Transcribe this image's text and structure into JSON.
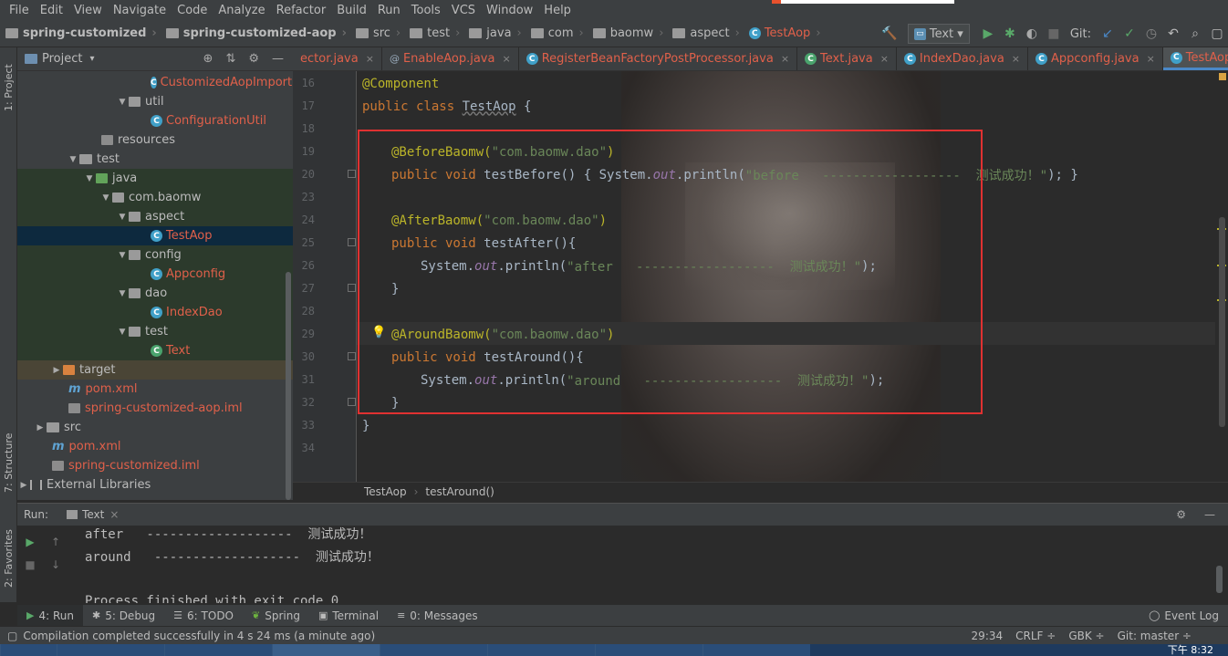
{
  "menu": [
    "File",
    "Edit",
    "View",
    "Navigate",
    "Code",
    "Analyze",
    "Refactor",
    "Build",
    "Run",
    "Tools",
    "VCS",
    "Window",
    "Help"
  ],
  "nav_breadcrumb": {
    "project": "spring-customized",
    "module": "spring-customized-aop",
    "path": [
      "src",
      "test",
      "java",
      "com",
      "baomw",
      "aspect"
    ],
    "file": "TestAop"
  },
  "toolbar": {
    "run_config": "Text",
    "git_label": "Git:"
  },
  "left_strip": {
    "project_tab": "1: Project",
    "structure_tab": "7: Structure",
    "favorites_tab": "2: Favorites"
  },
  "project_panel": {
    "title": "Project",
    "tree": [
      {
        "label": "CustomizedAopImportSelector",
        "kind": "class",
        "red": true
      },
      {
        "label": "util",
        "kind": "pkg"
      },
      {
        "label": "ConfigurationUtil",
        "kind": "class",
        "red": true
      },
      {
        "label": "resources",
        "kind": "res"
      },
      {
        "label": "test",
        "kind": "folder"
      },
      {
        "label": "java",
        "kind": "testsrc"
      },
      {
        "label": "com.baomw",
        "kind": "pkg"
      },
      {
        "label": "aspect",
        "kind": "pkg"
      },
      {
        "label": "TestAop",
        "kind": "class",
        "red": true,
        "selected": true
      },
      {
        "label": "config",
        "kind": "pkg"
      },
      {
        "label": "Appconfig",
        "kind": "class",
        "red": true
      },
      {
        "label": "dao",
        "kind": "pkg"
      },
      {
        "label": "IndexDao",
        "kind": "class",
        "red": true
      },
      {
        "label": "test",
        "kind": "pkg"
      },
      {
        "label": "Text",
        "kind": "class",
        "red": true
      },
      {
        "label": "target",
        "kind": "target"
      },
      {
        "label": "pom.xml",
        "kind": "m",
        "red": true
      },
      {
        "label": "spring-customized-aop.iml",
        "kind": "file",
        "red": true
      },
      {
        "label": "src",
        "kind": "folder"
      },
      {
        "label": "pom.xml",
        "kind": "m",
        "red": true
      },
      {
        "label": "spring-customized.iml",
        "kind": "file",
        "red": true
      },
      {
        "label": "External Libraries",
        "kind": "lib"
      }
    ]
  },
  "tabs": [
    {
      "label": "ector.java"
    },
    {
      "label": "EnableAop.java"
    },
    {
      "label": "RegisterBeanFactoryPostProcessor.java"
    },
    {
      "label": "Text.java"
    },
    {
      "label": "IndexDao.java"
    },
    {
      "label": "Appconfig.java"
    },
    {
      "label": "TestAop.java",
      "active": true
    }
  ],
  "tab_overflow": "≫4",
  "editor": {
    "line_numbers": [
      "16",
      "17",
      "18",
      "19",
      "20",
      "23",
      "24",
      "25",
      "26",
      "27",
      "28",
      "29",
      "30",
      "31",
      "32",
      "33",
      "34"
    ],
    "lines": {
      "l16": "@Component",
      "l17_kw": "public class ",
      "l17_name": "TestAop",
      "l17_tail": " {",
      "l19_ann": "@BeforeBaomw(",
      "l19_str": "\"com.baomw.dao\"",
      "l19_close": ")",
      "l20_kw": "public void ",
      "l20_name": "testBefore",
      "l20_a": "() { System.",
      "l20_out": "out",
      "l20_b": ".println(",
      "l20_str": "\"before   ------------------  测试成功！\"",
      "l20_c": "); }",
      "l24_ann": "@AfterBaomw(",
      "l24_str": "\"com.baomw.dao\"",
      "l24_close": ")",
      "l25_kw": "public void ",
      "l25_name": "testAfter",
      "l25_tail": "(){",
      "l26_a": "System.",
      "l26_out": "out",
      "l26_b": ".println(",
      "l26_str": "\"after   ------------------  测试成功！\"",
      "l26_c": ");",
      "l27": "}",
      "l29_ann": "@AroundBaomw(",
      "l29_str": "\"com.baomw.dao\"",
      "l29_close": ")",
      "l30_kw": "public void ",
      "l30_name": "testAround",
      "l30_tail": "(){",
      "l31_a": "System.",
      "l31_out": "out",
      "l31_b": ".println(",
      "l31_str": "\"around   ------------------  测试成功！\"",
      "l31_c": ");",
      "l32": "}",
      "l33": "}"
    }
  },
  "code_breadcrumb": [
    "TestAop",
    "testAround()"
  ],
  "run_panel": {
    "label": "Run:",
    "tab": "Text",
    "console": [
      "after   -------------------  测试成功！",
      "around   -------------------  测试成功！",
      "",
      "Process finished with exit code 0"
    ]
  },
  "bottom_tabs": {
    "run": "4: Run",
    "debug": "5: Debug",
    "todo": "6: TODO",
    "spring": "Spring",
    "terminal": "Terminal",
    "messages": "0: Messages",
    "event_log": "Event Log"
  },
  "status": {
    "message": "Compilation completed successfully in 4 s 24 ms (a minute ago)",
    "position": "29:34",
    "line_sep": "CRLF ÷",
    "encoding": "GBK ÷",
    "git_branch": "Git: master ÷"
  },
  "taskbar": {
    "clock": "下午 8:32"
  },
  "colors": {
    "accent_red_box": "#e03131",
    "error_file_red": "#e0604a",
    "selection": "#0d293e"
  }
}
